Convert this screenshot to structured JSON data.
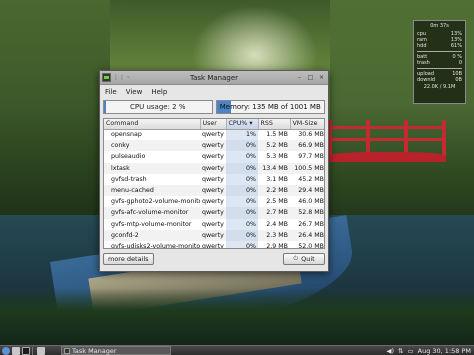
{
  "conky": {
    "uptime": "0m 37s",
    "stats": [
      {
        "label": "cpu",
        "value": "13%"
      },
      {
        "label": "ram",
        "value": "13%"
      },
      {
        "label": "hdd",
        "value": "61%"
      },
      {
        "label": "batt",
        "value": "0 %"
      },
      {
        "label": "trash",
        "value": "0"
      },
      {
        "label": "upload",
        "value": "10B"
      },
      {
        "label": "downld",
        "value": "0B"
      }
    ],
    "footer": "22.0K / 9.1M"
  },
  "window": {
    "title": "Task Manager",
    "menu": [
      "File",
      "View",
      "Help"
    ],
    "cpu_usage_label": "CPU usage: 2 %",
    "cpu_usage_fraction": 0.02,
    "memory_label": "Memory: 135 MB of 1001 MB used",
    "memory_fraction": 0.135,
    "columns": [
      "Command",
      "User",
      "CPU%",
      "RSS",
      "VM-Size"
    ],
    "sorted_column": "CPU%",
    "rows": [
      {
        "command": "opensnap",
        "user": "qwerty",
        "cpu": "1%",
        "rss": "1.5 MB",
        "vm": "30.6 MB"
      },
      {
        "command": "conky",
        "user": "qwerty",
        "cpu": "0%",
        "rss": "5.2 MB",
        "vm": "66.9 MB"
      },
      {
        "command": "pulseaudio",
        "user": "qwerty",
        "cpu": "0%",
        "rss": "5.3 MB",
        "vm": "97.7 MB"
      },
      {
        "command": "lxtask",
        "user": "qwerty",
        "cpu": "0%",
        "rss": "13.4 MB",
        "vm": "100.5 MB"
      },
      {
        "command": "gvfsd-trash",
        "user": "qwerty",
        "cpu": "0%",
        "rss": "3.1 MB",
        "vm": "45.2 MB"
      },
      {
        "command": "menu-cached",
        "user": "qwerty",
        "cpu": "0%",
        "rss": "2.2 MB",
        "vm": "29.4 MB"
      },
      {
        "command": "gvfs-gphoto2-volume-monitor",
        "user": "qwerty",
        "cpu": "0%",
        "rss": "2.5 MB",
        "vm": "46.0 MB"
      },
      {
        "command": "gvfs-afc-volume-monitor",
        "user": "qwerty",
        "cpu": "0%",
        "rss": "2.7 MB",
        "vm": "52.8 MB"
      },
      {
        "command": "gvfs-mtp-volume-monitor",
        "user": "qwerty",
        "cpu": "0%",
        "rss": "2.4 MB",
        "vm": "26.7 MB"
      },
      {
        "command": "gconfd-2",
        "user": "qwerty",
        "cpu": "0%",
        "rss": "2.3 MB",
        "vm": "26.4 MB"
      },
      {
        "command": "gvfs-udisks2-volume-monitor",
        "user": "qwerty",
        "cpu": "0%",
        "rss": "2.9 MB",
        "vm": "52.0 MB"
      }
    ],
    "more_details_label": "more details",
    "quit_label": "Quit"
  },
  "taskbar": {
    "task_label": "Task Manager",
    "clock": "Aug 30, 1:58 PM"
  },
  "colors": {
    "accent": "#4a83c8",
    "bridge": "#c42a30"
  }
}
